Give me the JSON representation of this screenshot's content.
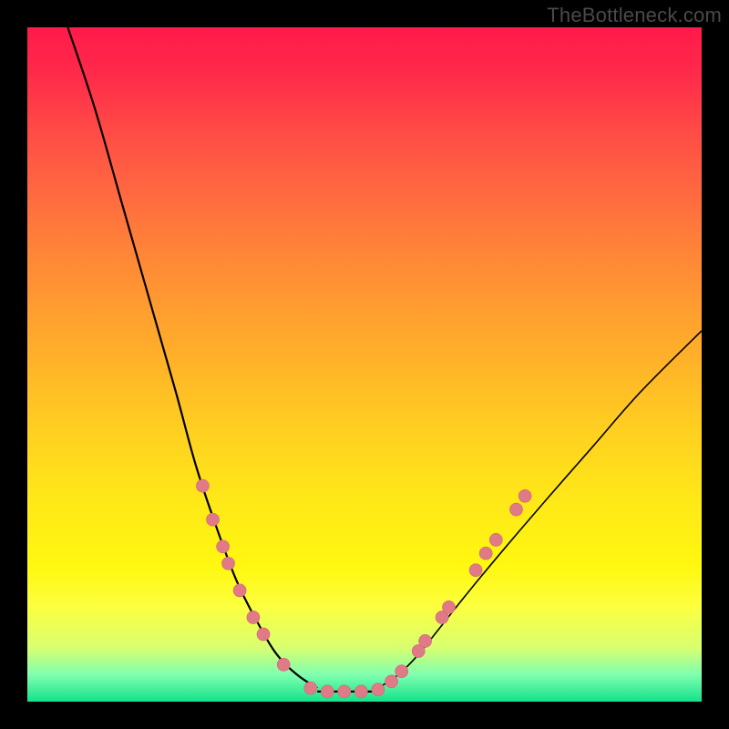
{
  "watermark": "TheBottleneck.com",
  "colors": {
    "frame": "#000000",
    "dot_fill": "#e07a86",
    "dot_stroke": "#d46a77",
    "curve": "#000000",
    "gradient_top": "#ff1a4b",
    "gradient_bottom": "#14e28a"
  },
  "chart_data": {
    "type": "line",
    "title": "",
    "xlabel": "",
    "ylabel": "",
    "x_range": [
      0,
      100
    ],
    "y_range": [
      0,
      100
    ],
    "note": "Axes are unlabeled in the source image; x and y are normalized 0–100 within the gradient plot area. y represents a bottleneck/penalty metric (high=red, low=green). Values are read approximately from pixel positions.",
    "series": [
      {
        "name": "left-curve",
        "description": "Steep descending curve from top-left toward the valley floor.",
        "points": [
          {
            "x": 6,
            "y": 100
          },
          {
            "x": 10,
            "y": 88
          },
          {
            "x": 14,
            "y": 74
          },
          {
            "x": 18,
            "y": 60
          },
          {
            "x": 22,
            "y": 46
          },
          {
            "x": 25,
            "y": 35
          },
          {
            "x": 28,
            "y": 26
          },
          {
            "x": 31,
            "y": 18
          },
          {
            "x": 34,
            "y": 12
          },
          {
            "x": 37,
            "y": 7
          },
          {
            "x": 40,
            "y": 4
          },
          {
            "x": 43,
            "y": 2
          }
        ]
      },
      {
        "name": "right-curve",
        "description": "Rising curve from the valley floor toward the upper-right.",
        "points": [
          {
            "x": 52,
            "y": 2
          },
          {
            "x": 55,
            "y": 4
          },
          {
            "x": 58,
            "y": 7
          },
          {
            "x": 62,
            "y": 12
          },
          {
            "x": 66,
            "y": 17
          },
          {
            "x": 71,
            "y": 23
          },
          {
            "x": 77,
            "y": 30
          },
          {
            "x": 84,
            "y": 38
          },
          {
            "x": 91,
            "y": 46
          },
          {
            "x": 100,
            "y": 55
          }
        ]
      },
      {
        "name": "valley-floor",
        "description": "Flat segment at the bottom connecting the two curves.",
        "points": [
          {
            "x": 43,
            "y": 1.5
          },
          {
            "x": 52,
            "y": 1.5
          }
        ]
      }
    ],
    "markers": {
      "name": "sample-dots",
      "description": "Salmon-colored circular markers placed along the lower portion of the curves and across the valley floor.",
      "radius_px": 7,
      "points": [
        {
          "x": 26.0,
          "y": 32.0
        },
        {
          "x": 27.5,
          "y": 27.0
        },
        {
          "x": 29.0,
          "y": 23.0
        },
        {
          "x": 29.8,
          "y": 20.5
        },
        {
          "x": 31.5,
          "y": 16.5
        },
        {
          "x": 33.5,
          "y": 12.5
        },
        {
          "x": 35.0,
          "y": 10.0
        },
        {
          "x": 38.0,
          "y": 5.5
        },
        {
          "x": 42.0,
          "y": 2.0
        },
        {
          "x": 44.5,
          "y": 1.5
        },
        {
          "x": 47.0,
          "y": 1.5
        },
        {
          "x": 49.5,
          "y": 1.5
        },
        {
          "x": 52.0,
          "y": 1.8
        },
        {
          "x": 54.0,
          "y": 3.0
        },
        {
          "x": 55.5,
          "y": 4.5
        },
        {
          "x": 58.0,
          "y": 7.5
        },
        {
          "x": 59.0,
          "y": 9.0
        },
        {
          "x": 61.5,
          "y": 12.5
        },
        {
          "x": 62.5,
          "y": 14.0
        },
        {
          "x": 66.5,
          "y": 19.5
        },
        {
          "x": 68.0,
          "y": 22.0
        },
        {
          "x": 69.5,
          "y": 24.0
        },
        {
          "x": 72.5,
          "y": 28.5
        },
        {
          "x": 73.8,
          "y": 30.5
        }
      ]
    }
  }
}
